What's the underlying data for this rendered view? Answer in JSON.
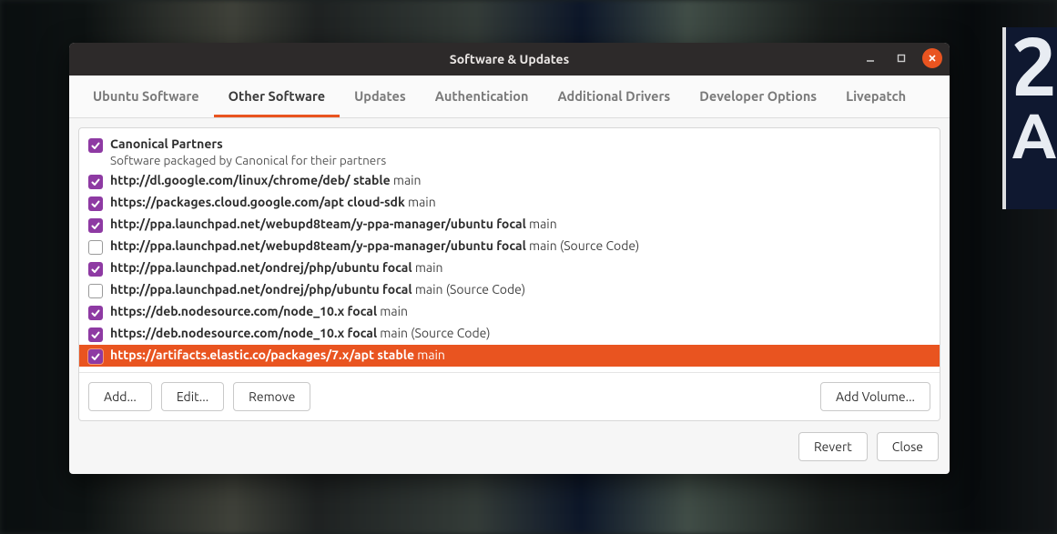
{
  "window": {
    "title": "Software & Updates"
  },
  "tabs": [
    {
      "label": "Ubuntu Software",
      "active": false
    },
    {
      "label": "Other Software",
      "active": true
    },
    {
      "label": "Updates",
      "active": false
    },
    {
      "label": "Authentication",
      "active": false
    },
    {
      "label": "Additional Drivers",
      "active": false
    },
    {
      "label": "Developer Options",
      "active": false
    },
    {
      "label": "Livepatch",
      "active": false
    }
  ],
  "sources": [
    {
      "checked": true,
      "selected": false,
      "bold": "Canonical Partners",
      "rest": "",
      "sub": "Software packaged by Canonical for their partners"
    },
    {
      "checked": true,
      "selected": false,
      "bold": "http://dl.google.com/linux/chrome/deb/ stable",
      "rest": " main"
    },
    {
      "checked": true,
      "selected": false,
      "bold": "https://packages.cloud.google.com/apt cloud-sdk",
      "rest": " main"
    },
    {
      "checked": true,
      "selected": false,
      "bold": "http://ppa.launchpad.net/webupd8team/y-ppa-manager/ubuntu focal",
      "rest": " main"
    },
    {
      "checked": false,
      "selected": false,
      "bold": "http://ppa.launchpad.net/webupd8team/y-ppa-manager/ubuntu focal",
      "rest": " main (Source Code)"
    },
    {
      "checked": true,
      "selected": false,
      "bold": "http://ppa.launchpad.net/ondrej/php/ubuntu focal",
      "rest": " main"
    },
    {
      "checked": false,
      "selected": false,
      "bold": "http://ppa.launchpad.net/ondrej/php/ubuntu focal",
      "rest": " main (Source Code)"
    },
    {
      "checked": true,
      "selected": false,
      "bold": "https://deb.nodesource.com/node_10.x focal",
      "rest": " main"
    },
    {
      "checked": true,
      "selected": false,
      "bold": "https://deb.nodesource.com/node_10.x focal",
      "rest": " main (Source Code)"
    },
    {
      "checked": true,
      "selected": true,
      "bold": "https://artifacts.elastic.co/packages/7.x/apt stable",
      "rest": " main"
    }
  ],
  "buttons": {
    "add": "Add...",
    "edit": "Edit...",
    "remove": "Remove",
    "add_volume": "Add Volume...",
    "revert": "Revert",
    "close": "Close"
  },
  "colors": {
    "accent": "#e95420",
    "checkbox": "#8e3aa3"
  }
}
